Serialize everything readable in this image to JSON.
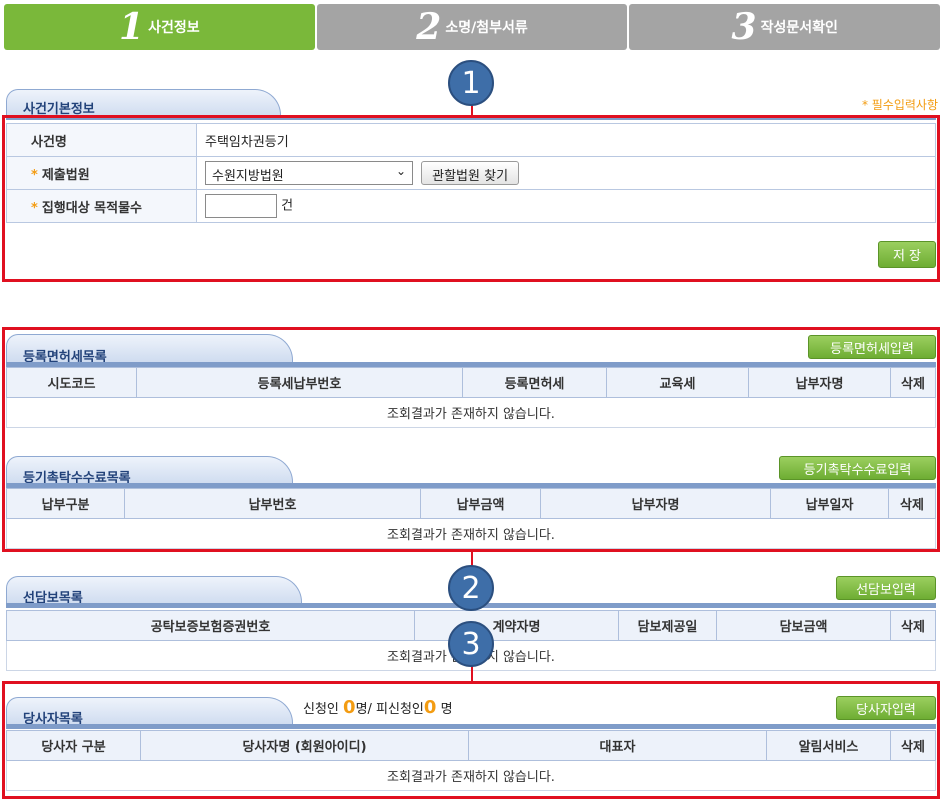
{
  "steps": [
    {
      "num": "1",
      "label": "사건정보"
    },
    {
      "num": "2",
      "label": "소명/첨부서류"
    },
    {
      "num": "3",
      "label": "작성문서확인"
    }
  ],
  "case_basic": {
    "title": "사건기본정보",
    "required_note": "* 필수입력사항",
    "case_name_label": "사건명",
    "case_name_value": "주택임차권등기",
    "court_label": "제출법원",
    "court_value": "수원지방법원",
    "court_find_button": "관할법원 찾기",
    "target_label": "집행대상 목적물수",
    "target_unit": "건",
    "save_button": "저 장"
  },
  "registration_tax": {
    "title": "등록면허세목록",
    "add_button": "등록면허세입력",
    "columns": [
      "시도코드",
      "등록세납부번호",
      "등록면허세",
      "교육세",
      "납부자명",
      "삭제"
    ],
    "empty_text": "조회결과가 존재하지 않습니다."
  },
  "commission_fee": {
    "title": "등기촉탁수수료목록",
    "add_button": "등기촉탁수수료입력",
    "columns": [
      "납부구분",
      "납부번호",
      "납부금액",
      "납부자명",
      "납부일자",
      "삭제"
    ],
    "empty_text": "조회결과가 존재하지 않습니다."
  },
  "security": {
    "title": "선담보목록",
    "add_button": "선담보입력",
    "columns": [
      "공탁보증보험증권번호",
      "계약자명",
      "담보제공일",
      "담보금액",
      "삭제"
    ],
    "empty_text": "조회결과가 존재하지 않습니다."
  },
  "parties": {
    "title": "당사자목록",
    "applicant_label": "신청인",
    "applicant_count": "0",
    "applicant_unit": "명/",
    "respondent_label": "피신청인",
    "respondent_count": "0",
    "respondent_unit": "명",
    "add_button": "당사자입력",
    "columns": [
      "당사자 구분",
      "당사자명 (회원아이디)",
      "대표자",
      "알림서비스",
      "삭제"
    ],
    "empty_text": "조회결과가 존재하지 않습니다."
  },
  "badges": [
    "1",
    "2",
    "3"
  ],
  "colors": {
    "step_active": "#7ab83a",
    "step_inactive": "#a4a4a4",
    "highlight": "#e01020",
    "accent": "#f39c12"
  }
}
